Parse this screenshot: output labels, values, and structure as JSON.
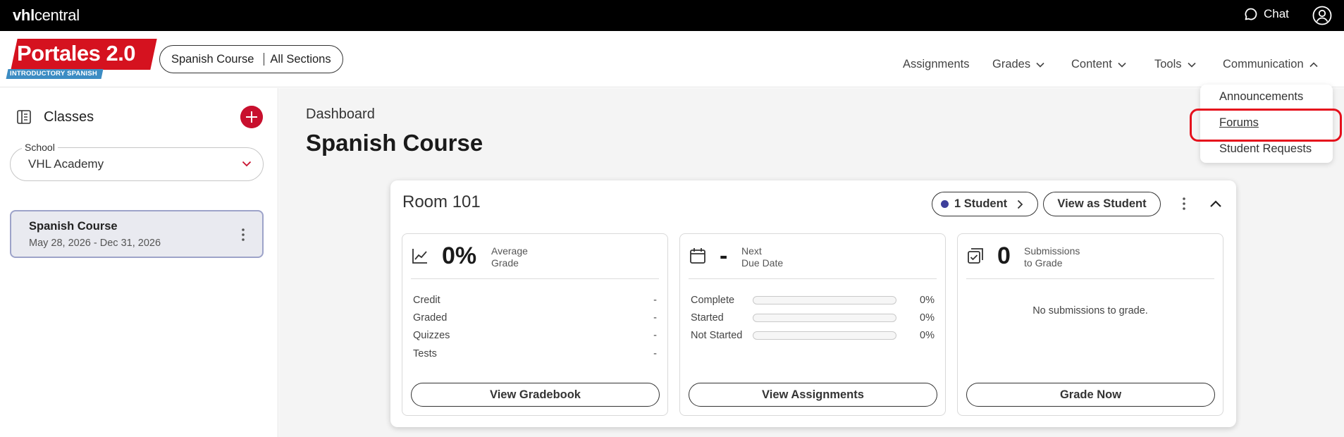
{
  "topbar": {
    "brand_bold": "vhl",
    "brand_rest": "central",
    "chat_label": "Chat"
  },
  "header": {
    "logo_title": "Portales 2.0",
    "logo_subtitle": "INTRODUCTORY SPANISH",
    "course_pill": {
      "course": "Spanish Course",
      "sections": "All Sections"
    },
    "nav": [
      "Assignments",
      "Grades",
      "Content",
      "Tools",
      "Communication"
    ]
  },
  "communication_menu": {
    "items": [
      "Announcements",
      "Forums",
      "Student Requests"
    ],
    "highlighted": "Forums"
  },
  "sidebar": {
    "title": "Classes",
    "school_label": "School",
    "school_value": "VHL Academy",
    "class_name": "Spanish Course",
    "class_dates": "May 28, 2026 - Dec 31, 2026"
  },
  "main": {
    "breadcrumb": "Dashboard",
    "title": "Spanish Course",
    "room": {
      "name": "Room 101",
      "students_label": "1 Student",
      "view_as_student": "View as Student",
      "grade_card": {
        "value": "0%",
        "label_line1": "Average",
        "label_line2": "Grade",
        "rows": [
          {
            "label": "Credit",
            "value": "-"
          },
          {
            "label": "Graded",
            "value": "-"
          },
          {
            "label": "Quizzes",
            "value": "-"
          },
          {
            "label": "Tests",
            "value": "-"
          }
        ],
        "button": "View Gradebook"
      },
      "due_card": {
        "value": "-",
        "label_line1": "Next",
        "label_line2": "Due Date",
        "rows": [
          {
            "label": "Complete",
            "value": "0%",
            "progress": 0
          },
          {
            "label": "Started",
            "value": "0%",
            "progress": 0
          },
          {
            "label": "Not Started",
            "value": "0%",
            "progress": 0
          }
        ],
        "button": "View Assignments"
      },
      "submissions_card": {
        "value": "0",
        "label_line1": "Submissions",
        "label_line2": "to Grade",
        "empty_message": "No submissions to grade.",
        "button": "Grade Now"
      }
    }
  },
  "colors": {
    "accent_red": "#c8102e",
    "highlight_red": "#e5101c",
    "student_dot": "#3d3f9b"
  }
}
